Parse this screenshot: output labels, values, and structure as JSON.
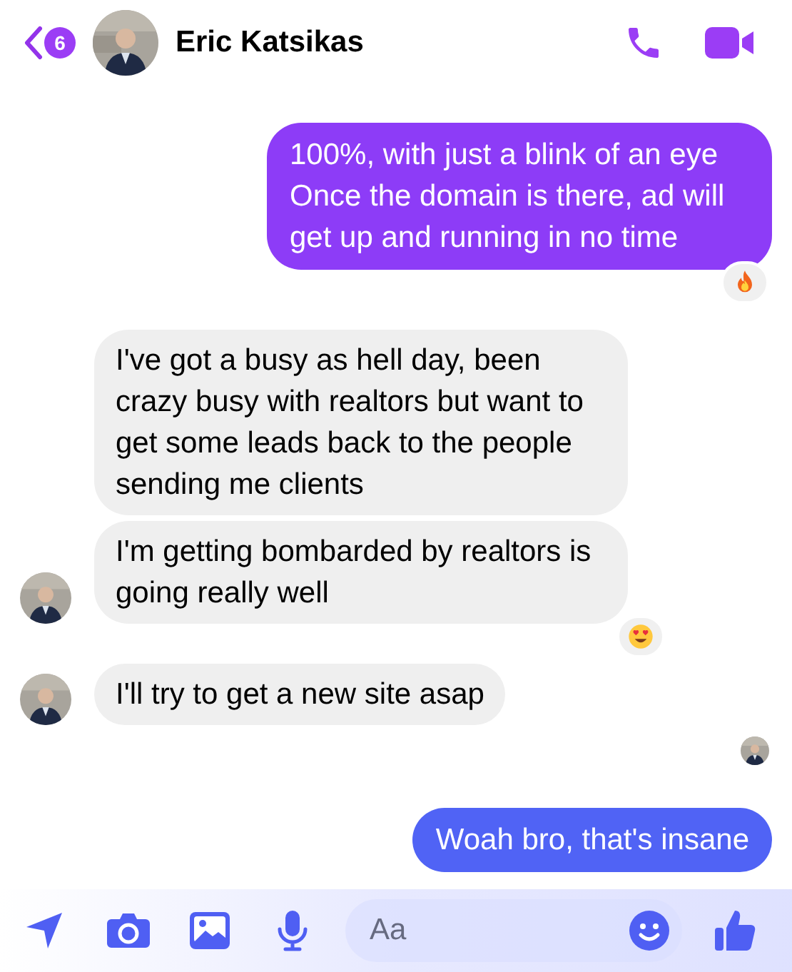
{
  "header": {
    "back_badge": "6",
    "contact_name": "Eric Katsikas"
  },
  "messages": [
    {
      "kind": "sent",
      "text": "100%, with just a blink of an eye\nOnce the domain is there, ad will get up and running in no time",
      "reaction": {
        "kind": "fire"
      }
    },
    {
      "kind": "received",
      "text": "I've got a busy as hell day, been crazy busy with realtors but want to get some leads back to the people sending me clients",
      "avatar": false
    },
    {
      "kind": "received",
      "text": "I'm getting bombarded by realtors is going really well",
      "avatar": true,
      "reaction": {
        "kind": "heart-eyes"
      }
    },
    {
      "kind": "received",
      "text": "I'll try to get a new site asap",
      "avatar": true
    },
    {
      "kind": "seen"
    },
    {
      "kind": "sent",
      "text": "Woah bro, that's insane",
      "color": "#5063f5"
    }
  ],
  "composer": {
    "placeholder": "Aa"
  }
}
